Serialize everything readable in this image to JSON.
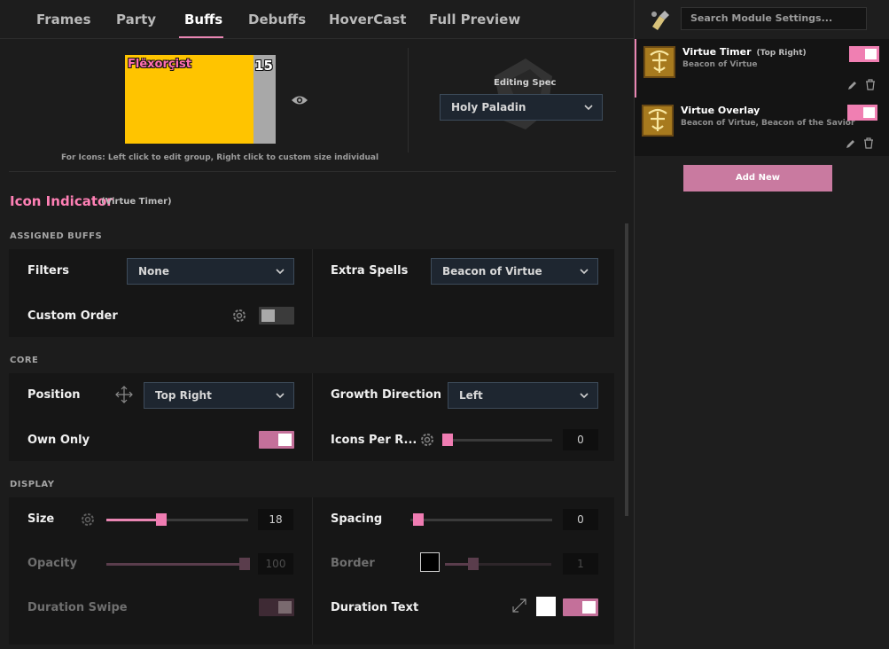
{
  "tabs": [
    {
      "label": "Frames"
    },
    {
      "label": "Party"
    },
    {
      "label": "Buffs"
    },
    {
      "label": "Debuffs"
    },
    {
      "label": "HoverCast"
    },
    {
      "label": "Full Preview"
    }
  ],
  "active_tab": "Buffs",
  "preview": {
    "unit_name": "Flëxorçist",
    "count": "15",
    "hint": "For Icons: Left click to edit group, Right click to custom size individual",
    "editing_spec_label": "Editing Spec",
    "spec_value": "Holy Paladin"
  },
  "section": {
    "title": "Icon Indicator",
    "subtitle": "(Virtue Timer)"
  },
  "assigned_buffs": {
    "heading": "ASSIGNED BUFFS",
    "filters_label": "Filters",
    "filters_value": "None",
    "extra_spells_label": "Extra Spells",
    "extra_spells_value": "Beacon of Virtue",
    "custom_order_label": "Custom Order",
    "custom_order_enabled": false
  },
  "core": {
    "heading": "CORE",
    "position_label": "Position",
    "position_value": "Top Right",
    "growth_label": "Growth Direction",
    "growth_value": "Left",
    "own_only_label": "Own Only",
    "own_only_enabled": true,
    "icons_per_row_label": "Icons Per R...",
    "icons_per_row_value": "0"
  },
  "display": {
    "heading": "DISPLAY",
    "size_label": "Size",
    "size_value": "18",
    "spacing_label": "Spacing",
    "spacing_value": "0",
    "opacity_label": "Opacity",
    "opacity_value": "100",
    "border_label": "Border",
    "border_value": "1",
    "duration_swipe_label": "Duration Swipe",
    "duration_text_label": "Duration Text",
    "duration_text_enabled": true
  },
  "sidebar": {
    "search_placeholder": "Search Module Settings...",
    "modules": [
      {
        "title": "Virtue Timer",
        "tag": "(Top Right)",
        "subtitle": "Beacon of Virtue",
        "enabled": true
      },
      {
        "title": "Virtue Overlay",
        "tag": "",
        "subtitle": "Beacon of Virtue, Beacon of the Savior",
        "enabled": true
      }
    ],
    "add_label": "Add New"
  },
  "colors": {
    "accent": "#e986b3",
    "unit_frame": "#ffc400",
    "panel_bg": "#1c1c1c"
  }
}
